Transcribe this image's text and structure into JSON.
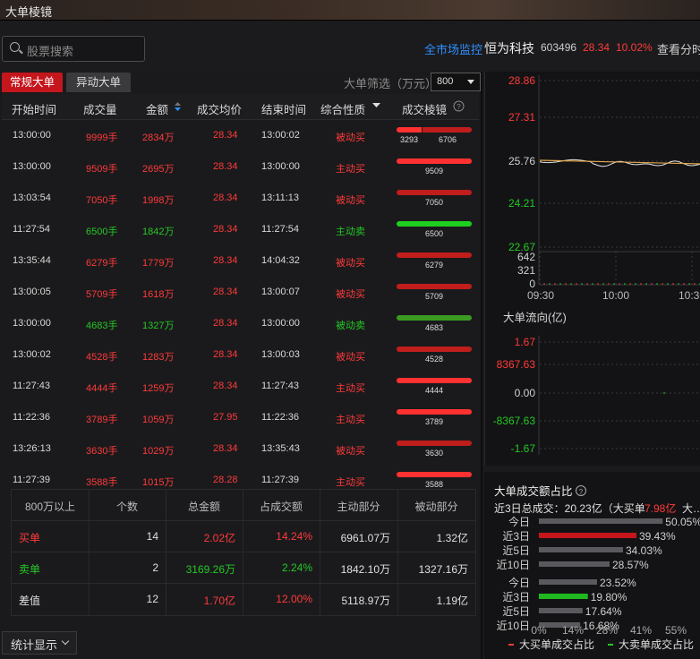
{
  "window": {
    "title": "大单棱镜"
  },
  "search": {
    "placeholder": "股票搜索"
  },
  "header": {
    "monitor_link": "全市场监控",
    "stock_name": "恒为科技",
    "stock_code": "603496",
    "price": "28.34",
    "change_pct": "10.02%",
    "view_time": "查看分时"
  },
  "tabs": [
    {
      "label": "常规大单",
      "active": true
    },
    {
      "label": "异动大单",
      "active": false
    }
  ],
  "filter": {
    "label": "大单筛选（万元）",
    "value": "800"
  },
  "table": {
    "columns": [
      "开始时间",
      "成交量",
      "金额",
      "成交均价",
      "结束时间",
      "综合性质",
      "成交棱镜"
    ],
    "rows": [
      {
        "start": "13:00:00",
        "volume": "9999手",
        "amount": "2834万",
        "avg": "28.34",
        "end": "13:00:02",
        "nature": "被动买",
        "color": "red",
        "bar_type": "split",
        "split_a": "3293",
        "split_b": "6706",
        "split_frac": 0.33,
        "bar_label": ""
      },
      {
        "start": "13:00:00",
        "volume": "9509手",
        "amount": "2695万",
        "avg": "28.34",
        "end": "13:00:00",
        "nature": "主动买",
        "color": "red",
        "bar_type": "active-buy",
        "bar_label": "9509"
      },
      {
        "start": "13:03:54",
        "volume": "7050手",
        "amount": "1998万",
        "avg": "28.34",
        "end": "13:11:13",
        "nature": "被动买",
        "color": "red",
        "bar_type": "passive-buy",
        "bar_label": "7050"
      },
      {
        "start": "11:27:54",
        "volume": "6500手",
        "amount": "1842万",
        "avg": "28.34",
        "end": "11:27:54",
        "nature": "主动卖",
        "color": "green",
        "bar_type": "active-sell",
        "bar_label": "6500"
      },
      {
        "start": "13:35:44",
        "volume": "6279手",
        "amount": "1779万",
        "avg": "28.34",
        "end": "14:04:32",
        "nature": "被动买",
        "color": "red",
        "bar_type": "passive-buy",
        "bar_label": "6279"
      },
      {
        "start": "13:00:05",
        "volume": "5709手",
        "amount": "1618万",
        "avg": "28.34",
        "end": "13:00:07",
        "nature": "被动买",
        "color": "red",
        "bar_type": "passive-buy",
        "bar_label": "5709"
      },
      {
        "start": "13:00:00",
        "volume": "4683手",
        "amount": "1327万",
        "avg": "28.34",
        "end": "13:00:00",
        "nature": "被动卖",
        "color": "green",
        "bar_type": "passive-sell",
        "bar_label": "4683"
      },
      {
        "start": "13:00:02",
        "volume": "4528手",
        "amount": "1283万",
        "avg": "28.34",
        "end": "13:00:03",
        "nature": "被动买",
        "color": "red",
        "bar_type": "passive-buy",
        "bar_label": "4528"
      },
      {
        "start": "11:27:43",
        "volume": "4444手",
        "amount": "1259万",
        "avg": "28.34",
        "end": "11:27:43",
        "nature": "主动买",
        "color": "red",
        "bar_type": "active-buy",
        "bar_label": "4444"
      },
      {
        "start": "11:22:36",
        "volume": "3789手",
        "amount": "1059万",
        "avg": "27.95",
        "end": "11:22:36",
        "nature": "主动买",
        "color": "red",
        "bar_type": "active-buy",
        "bar_label": "3789"
      },
      {
        "start": "13:26:13",
        "volume": "3630手",
        "amount": "1029万",
        "avg": "28.34",
        "end": "13:35:43",
        "nature": "被动买",
        "color": "red",
        "bar_type": "passive-buy",
        "bar_label": "3630"
      },
      {
        "start": "11:27:39",
        "volume": "3588手",
        "amount": "1015万",
        "avg": "28.28",
        "end": "11:27:39",
        "nature": "主动买",
        "color": "red",
        "bar_type": "active-buy",
        "bar_label": "3588"
      }
    ]
  },
  "summary": {
    "headers": [
      "800万以上",
      "个数",
      "总金额",
      "占成交额",
      "主动部分",
      "被动部分"
    ],
    "rows": [
      {
        "label": "买单",
        "count": "14",
        "total": "2.02亿",
        "ratio": "14.24%",
        "active": "6961.07万",
        "passive": "1.32亿",
        "color": "red"
      },
      {
        "label": "卖单",
        "count": "2",
        "total": "3169.26万",
        "ratio": "2.24%",
        "active": "1842.10万",
        "passive": "1327.16万",
        "color": "green"
      },
      {
        "label": "差值",
        "count": "12",
        "total": "1.70亿",
        "ratio": "12.00%",
        "active": "5118.97万",
        "passive": "1.19亿",
        "color": "red"
      }
    ]
  },
  "footer": {
    "stats_label": "统计显示"
  },
  "price_chart": {
    "y_labels": [
      "28.86",
      "27.31",
      "25.76",
      "24.21",
      "22.67"
    ],
    "vol_labels": [
      "642",
      "321",
      "0"
    ],
    "x_labels": [
      "09:30",
      "10:00",
      "10:30"
    ]
  },
  "flow_chart": {
    "title": "大单流向(亿)",
    "y_labels": [
      "1.67",
      "8367.63",
      "0.00",
      "-8367.63",
      "-1.67"
    ]
  },
  "ratio_panel": {
    "title": "大单成交额占比",
    "info": "近3日总成交：20.23亿（大买单",
    "info_red": "7.98亿",
    "info_tail": "大…",
    "buy_rows": [
      {
        "label": "今日",
        "value": 50.05,
        "text": "50.05%"
      },
      {
        "label": "近3日",
        "value": 39.43,
        "text": "39.43%"
      },
      {
        "label": "近5日",
        "value": 34.03,
        "text": "34.03%"
      },
      {
        "label": "近10日",
        "value": 28.57,
        "text": "28.57%"
      }
    ],
    "sell_rows": [
      {
        "label": "今日",
        "value": 23.52,
        "text": "23.52%"
      },
      {
        "label": "近3日",
        "value": 19.8,
        "text": "19.80%"
      },
      {
        "label": "近5日",
        "value": 17.64,
        "text": "17.64%"
      },
      {
        "label": "近10日",
        "value": 16.68,
        "text": "16.68%"
      }
    ],
    "x_ticks": [
      "0%",
      "14%",
      "28%",
      "41%",
      "55%"
    ],
    "legend_buy": "大买单成交占比",
    "legend_sell": "大卖单成交占比"
  }
}
